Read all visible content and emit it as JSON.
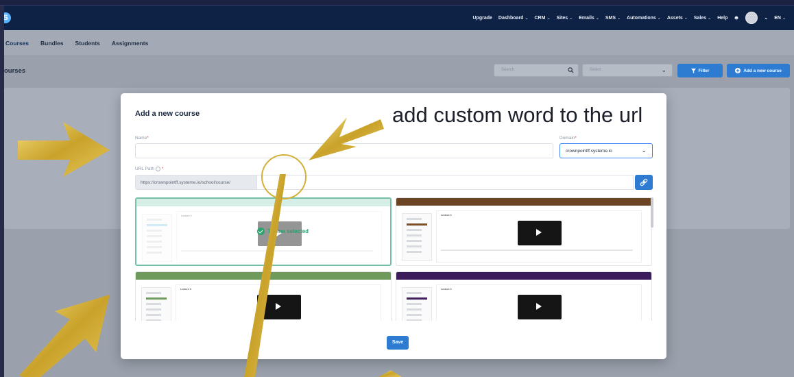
{
  "nav": {
    "items": [
      {
        "label": "Upgrade",
        "chevron": false
      },
      {
        "label": "Dashboard",
        "chevron": true
      },
      {
        "label": "CRM",
        "chevron": true
      },
      {
        "label": "Sites",
        "chevron": true
      },
      {
        "label": "Emails",
        "chevron": true
      },
      {
        "label": "SMS",
        "chevron": true
      },
      {
        "label": "Automations",
        "chevron": true
      },
      {
        "label": "Assets",
        "chevron": true
      },
      {
        "label": "Sales",
        "chevron": true
      },
      {
        "label": "Help",
        "chevron": false
      }
    ],
    "language": "EN"
  },
  "subnav": {
    "tabs": [
      "Courses",
      "Bundles",
      "Students",
      "Assignments"
    ],
    "active": "Courses"
  },
  "page": {
    "title": "ourses",
    "search_placeholder": "Search",
    "select_placeholder": "Select",
    "filter_label": "Filter",
    "add_label": "Add a new course"
  },
  "modal": {
    "title": "Add a new course",
    "name_label": "Name",
    "name_value": "",
    "domain_label": "Domain",
    "domain_value": "crownpointff.systeme.io",
    "url_label": "URL Path",
    "url_prefix": "https://crownpointff.systeme.io/school/course/",
    "url_value": "",
    "selected_theme_text": "Theme selected",
    "themes": [
      {
        "bar_color": "#a3d9c7",
        "accent": "#9ccff0",
        "selected": true
      },
      {
        "bar_color": "#6b4423",
        "accent": "#7a4f2a",
        "selected": false
      },
      {
        "bar_color": "#6e9b5c",
        "accent": "#6e9b5c",
        "selected": false
      },
      {
        "bar_color": "#3d1c5c",
        "accent": "#3d1c5c",
        "selected": false
      }
    ],
    "lecture_label": "Lecture 3",
    "save_label": "Save"
  },
  "annotation": {
    "text": "add custom word to the url",
    "arrow_color": "#d4b03a"
  }
}
